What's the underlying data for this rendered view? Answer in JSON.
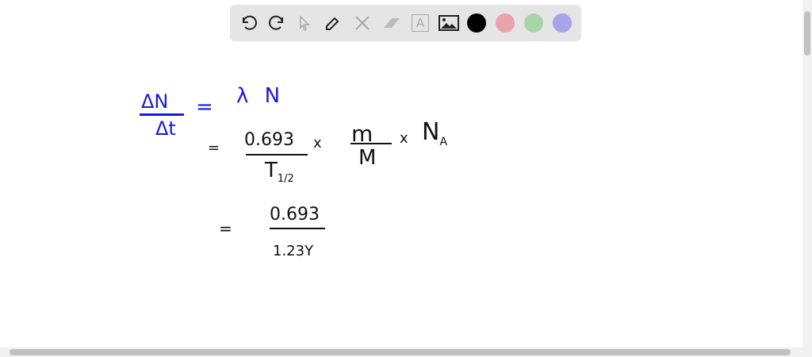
{
  "toolbar": {
    "tools": [
      "undo-icon",
      "redo-icon",
      "pointer-icon",
      "pen-icon",
      "tools-icon",
      "eraser-icon",
      "text-icon",
      "image-icon"
    ],
    "colors": [
      "#000000",
      "#e8a3ab",
      "#a9d3a9",
      "#a9a3e8"
    ],
    "text_tool_glyph": "A"
  },
  "canvas": {
    "line1": {
      "numerator": "ΔN",
      "denominator": "Δt",
      "equals": "=",
      "rhs": "λ N"
    },
    "line2": {
      "equals": "=",
      "num1": "0.693",
      "den1": "T",
      "den1_sub": "1/2",
      "times1": "x",
      "num2": "m",
      "den2": "M",
      "times2": "x",
      "n": "N",
      "n_sub": "A"
    },
    "line3": {
      "equals": "=",
      "numerator": "0.693",
      "denominator": "1.23Y"
    }
  }
}
